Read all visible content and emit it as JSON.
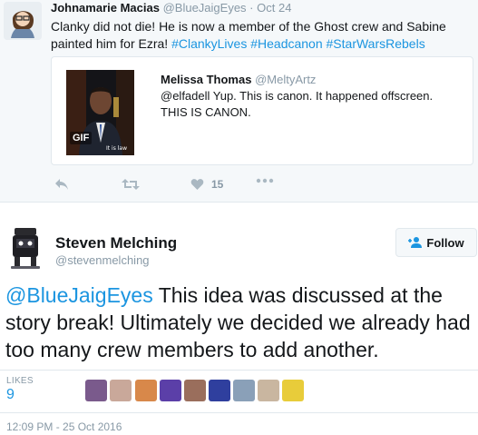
{
  "top_tweet": {
    "name": "Johnamarie Macias",
    "handle": "@BlueJaigEyes",
    "separator": "·",
    "date": "Oct 24",
    "text_plain": "Clanky did not die! He is now a member of the Ghost crew and Sabine painted him for Ezra! ",
    "hashtags": [
      "#ClankyLives",
      "#Headcanon",
      "#StarWarsRebels"
    ],
    "quote": {
      "name": "Melissa Thomas",
      "handle": "@MeltyArtz",
      "text": "@elfadell Yup. This is canon. It happened offscreen. THIS IS CANON.",
      "gif_badge": "GIF",
      "gif_caption": "It is law"
    },
    "actions": {
      "reply_icon": "reply-icon",
      "retweet_icon": "retweet-icon",
      "like_icon": "heart-icon",
      "like_count": "15",
      "more_icon": "more-icon"
    }
  },
  "tweet": {
    "name": "Steven Melching",
    "handle": "@stevenmelching",
    "follow_label": "Follow",
    "mention": "@BlueJaigEyes",
    "text": " This idea was discussed at the story break! Ultimately we decided we already had too many crew members to add another.",
    "likes_label": "LIKES",
    "likes_count": "9",
    "timestamp": "12:09 PM - 25 Oct 2016",
    "likers": [
      {
        "color": "#7a5a8c"
      },
      {
        "color": "#c9a89a"
      },
      {
        "color": "#d8884a"
      },
      {
        "color": "#5b3fa8"
      },
      {
        "color": "#9a6e5c"
      },
      {
        "color": "#2f3f9e"
      },
      {
        "color": "#8aa0b8"
      },
      {
        "color": "#c9b6a0"
      },
      {
        "color": "#e8cc3a"
      }
    ]
  },
  "colors": {
    "link": "#1b95e0",
    "muted": "#8899a6",
    "border": "#e1e8ed",
    "tweet_bg": "#f5f8fa"
  }
}
